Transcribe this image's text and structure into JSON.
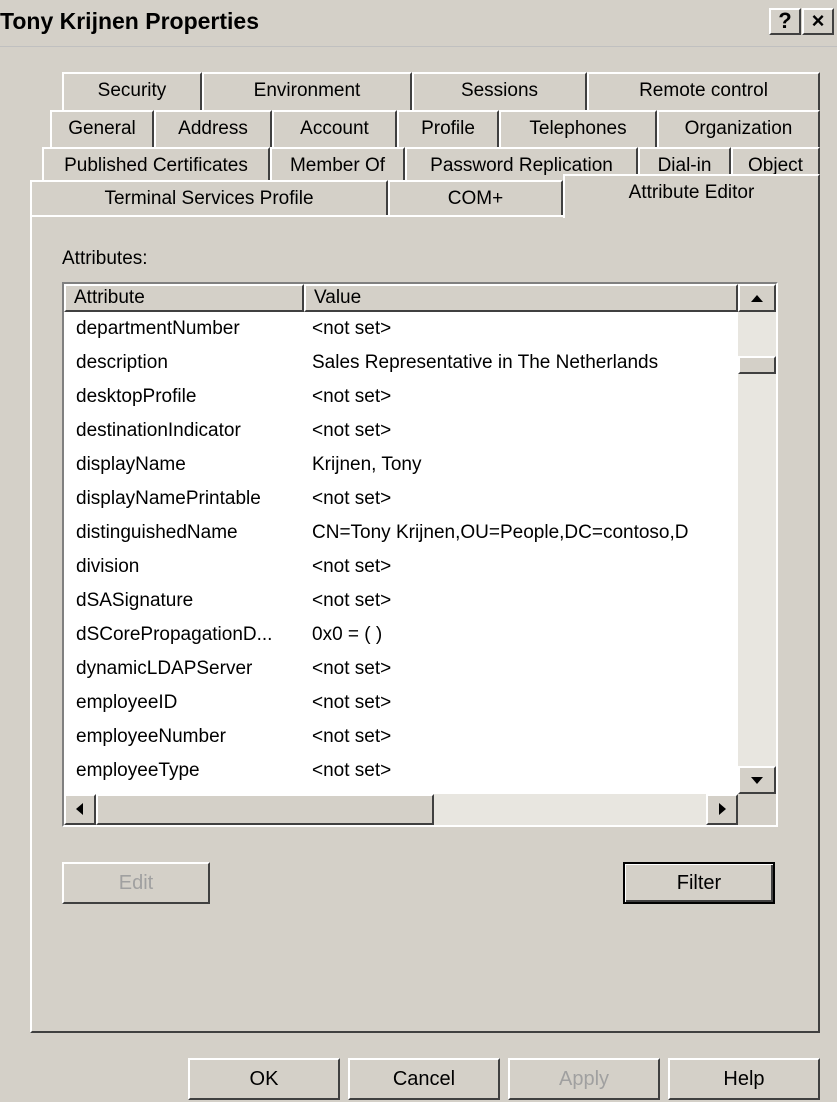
{
  "window": {
    "title": "Tony Krijnen Properties",
    "help_button": "?",
    "close_button": "×"
  },
  "tabs": {
    "row1": [
      "Security",
      "Environment",
      "Sessions",
      "Remote control"
    ],
    "row2": [
      "General",
      "Address",
      "Account",
      "Profile",
      "Telephones",
      "Organization"
    ],
    "row3": [
      "Published Certificates",
      "Member Of",
      "Password Replication",
      "Dial-in",
      "Object"
    ],
    "row4": [
      "Terminal Services Profile",
      "COM+",
      "Attribute Editor"
    ],
    "active": "Attribute Editor"
  },
  "attributes_label": "Attributes:",
  "table": {
    "columns": [
      "Attribute",
      "Value"
    ],
    "rows": [
      {
        "attribute": "departmentNumber",
        "value": "<not set>"
      },
      {
        "attribute": "description",
        "value": "Sales Representative in The Netherlands"
      },
      {
        "attribute": "desktopProfile",
        "value": "<not set>"
      },
      {
        "attribute": "destinationIndicator",
        "value": "<not set>"
      },
      {
        "attribute": "displayName",
        "value": "Krijnen, Tony"
      },
      {
        "attribute": "displayNamePrintable",
        "value": "<not set>"
      },
      {
        "attribute": "distinguishedName",
        "value": "CN=Tony Krijnen,OU=People,DC=contoso,D"
      },
      {
        "attribute": "division",
        "value": "<not set>"
      },
      {
        "attribute": "dSASignature",
        "value": "<not set>"
      },
      {
        "attribute": "dSCorePropagationD...",
        "value": "0x0 = ( )"
      },
      {
        "attribute": "dynamicLDAPServer",
        "value": "<not set>"
      },
      {
        "attribute": "employeeID",
        "value": "<not set>"
      },
      {
        "attribute": "employeeNumber",
        "value": "<not set>"
      },
      {
        "attribute": "employeeType",
        "value": "<not set>"
      }
    ]
  },
  "buttons": {
    "edit": "Edit",
    "filter": "Filter",
    "ok": "OK",
    "cancel": "Cancel",
    "apply": "Apply",
    "help": "Help"
  },
  "icons": {
    "scroll_up": "scroll-up-arrow",
    "scroll_down": "scroll-down-arrow",
    "scroll_left": "scroll-left-arrow",
    "scroll_right": "scroll-right-arrow"
  }
}
